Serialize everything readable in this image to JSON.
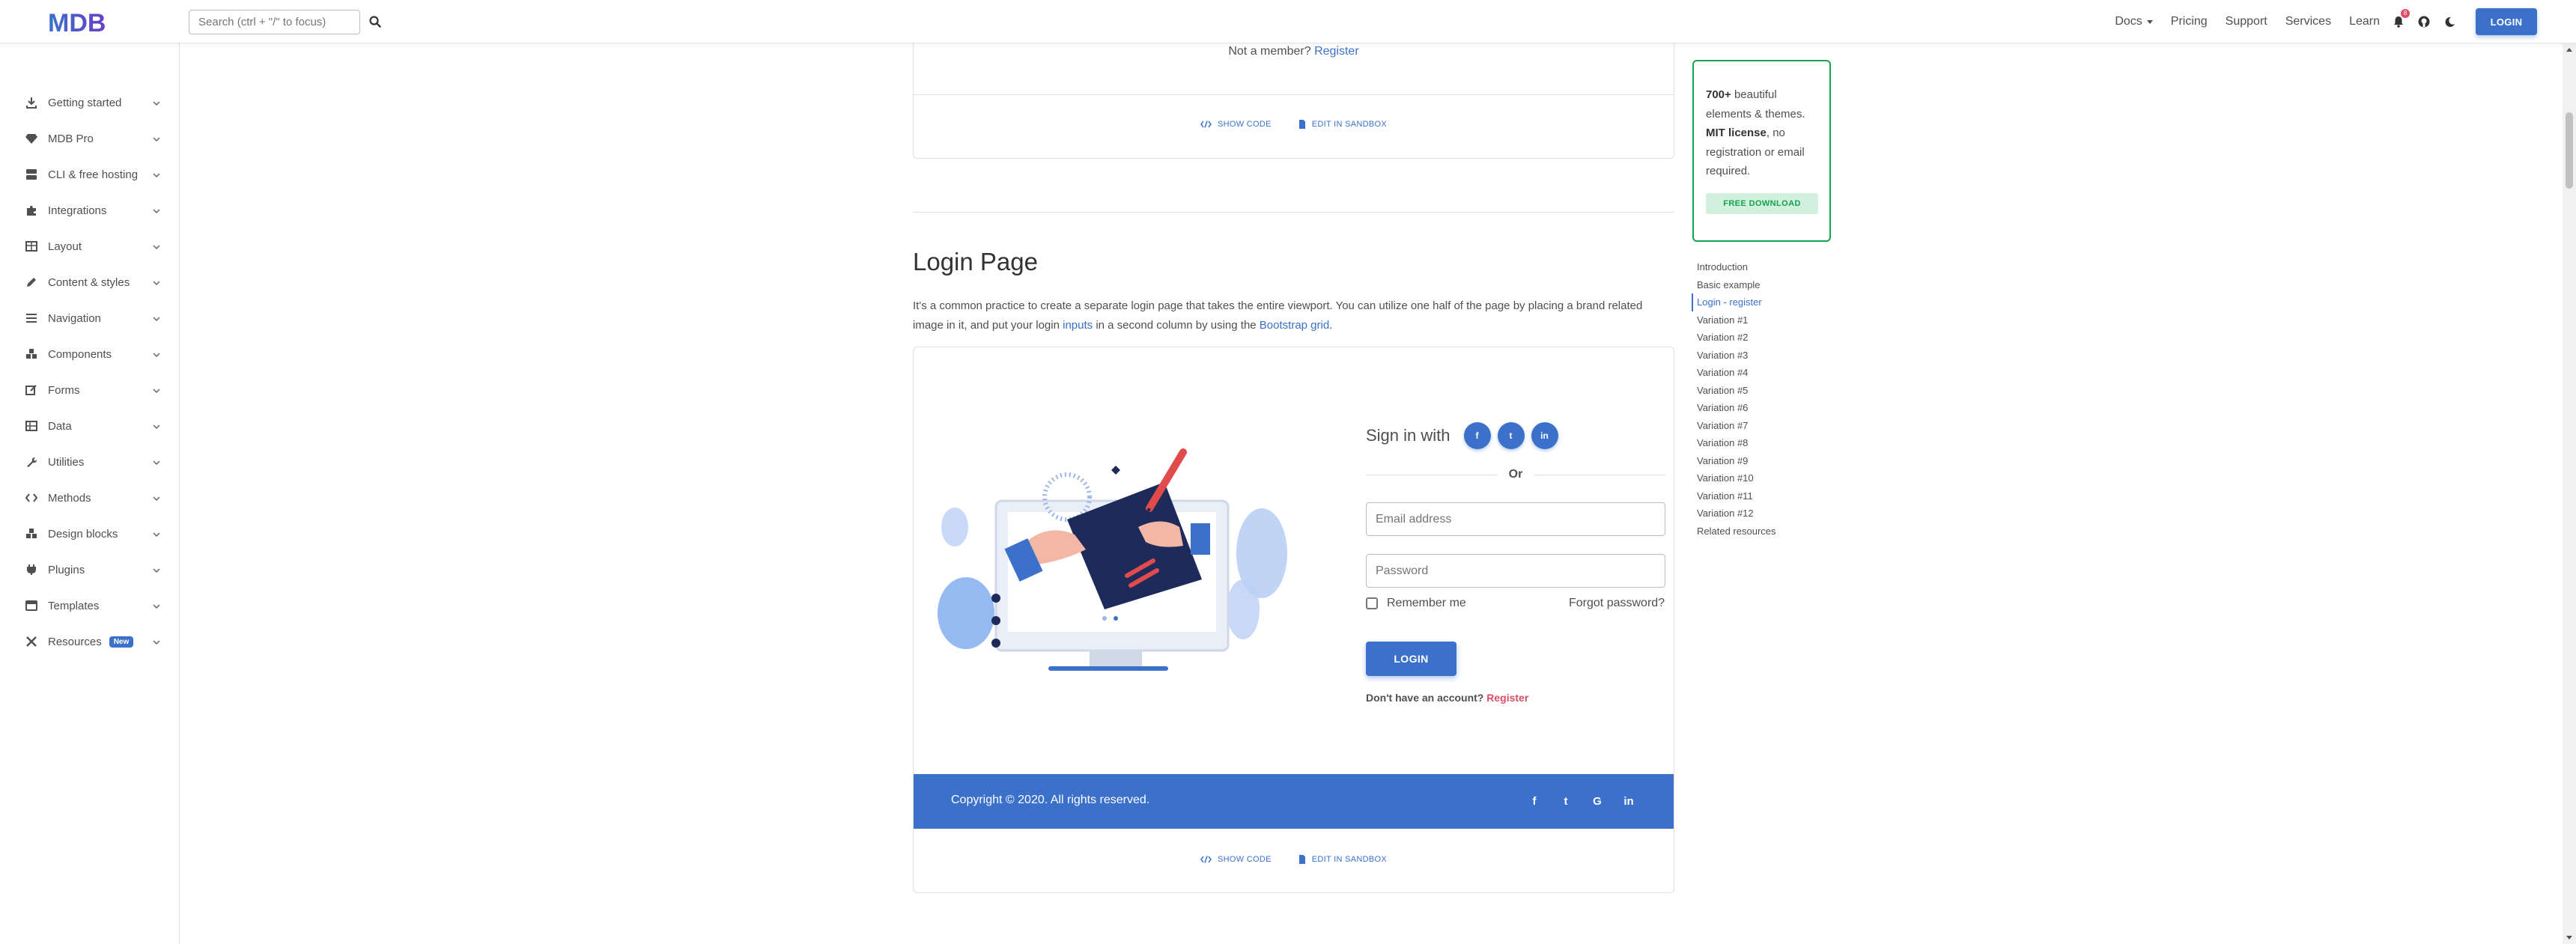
{
  "colors": {
    "primary": "#3b71ca",
    "success": "#14a44d",
    "danger": "#dc4c64",
    "text": "#4f4f4f"
  },
  "logo": {
    "text": "MDB"
  },
  "search": {
    "placeholder": "Search (ctrl + \"/\" to focus)",
    "icon": "search-icon"
  },
  "nav": {
    "links": [
      "Docs",
      "Pricing",
      "Support",
      "Services",
      "Learn"
    ],
    "notification_count": "8",
    "login_label": "LOGIN",
    "icons": [
      "bell-icon",
      "github-icon",
      "moon-icon"
    ]
  },
  "sidebar": {
    "items": [
      {
        "label": "Getting started",
        "icon": "download-icon"
      },
      {
        "label": "MDB Pro",
        "icon": "gem-icon"
      },
      {
        "label": "CLI & free hosting",
        "icon": "server-icon"
      },
      {
        "label": "Integrations",
        "icon": "puzzle-icon"
      },
      {
        "label": "Layout",
        "icon": "table-icon"
      },
      {
        "label": "Content & styles",
        "icon": "pencil-icon"
      },
      {
        "label": "Navigation",
        "icon": "bars-icon"
      },
      {
        "label": "Components",
        "icon": "cubes-icon"
      },
      {
        "label": "Forms",
        "icon": "edit-icon"
      },
      {
        "label": "Data",
        "icon": "grid-icon"
      },
      {
        "label": "Utilities",
        "icon": "wrench-icon"
      },
      {
        "label": "Methods",
        "icon": "code-icon"
      },
      {
        "label": "Design blocks",
        "icon": "cubes-icon"
      },
      {
        "label": "Plugins",
        "icon": "plug-icon"
      },
      {
        "label": "Templates",
        "icon": "window-icon"
      },
      {
        "label": "Resources",
        "icon": "tools-icon",
        "badge": "New"
      }
    ]
  },
  "top_card": {
    "not_member": "Not a member?",
    "register_link": "Register",
    "show_code": "SHOW CODE",
    "edit_sandbox": "EDIT IN SANDBOX"
  },
  "section": {
    "title": "Login Page",
    "desc_part1": "It's a common practice to create a separate login page that takes the entire viewport. You can utilize one half of the page by placing a brand related image in it, and put your login ",
    "desc_link1": "inputs",
    "desc_part2": " in a second column by using the ",
    "desc_link2": "Bootstrap grid",
    "desc_part3": "."
  },
  "login_demo": {
    "sign_in_with": "Sign in with",
    "socials": [
      "f",
      "t",
      "in"
    ],
    "or": "Or",
    "email_placeholder": "Email address",
    "password_placeholder": "Password",
    "remember_me": "Remember me",
    "forgot": "Forgot password?",
    "login_button": "LOGIN",
    "no_account": "Don't have an account?",
    "register": "Register",
    "footer_copyright": "Copyright © 2020. All rights reserved.",
    "footer_socials": [
      "f",
      "t",
      "G",
      "in"
    ]
  },
  "bottom_card": {
    "show_code": "SHOW CODE",
    "edit_sandbox": "EDIT IN SANDBOX"
  },
  "promo": {
    "bold1": "700+",
    "text1": " beautiful elements & themes.",
    "bold2": "MIT license",
    "text2": ", no registration or email required.",
    "button": "FREE DOWNLOAD"
  },
  "toc": {
    "active_index": 2,
    "items": [
      "Introduction",
      "Basic example",
      "Login - register",
      "Variation #1",
      "Variation #2",
      "Variation #3",
      "Variation #4",
      "Variation #5",
      "Variation #6",
      "Variation #7",
      "Variation #8",
      "Variation #9",
      "Variation #10",
      "Variation #11",
      "Variation #12",
      "Related resources"
    ]
  }
}
